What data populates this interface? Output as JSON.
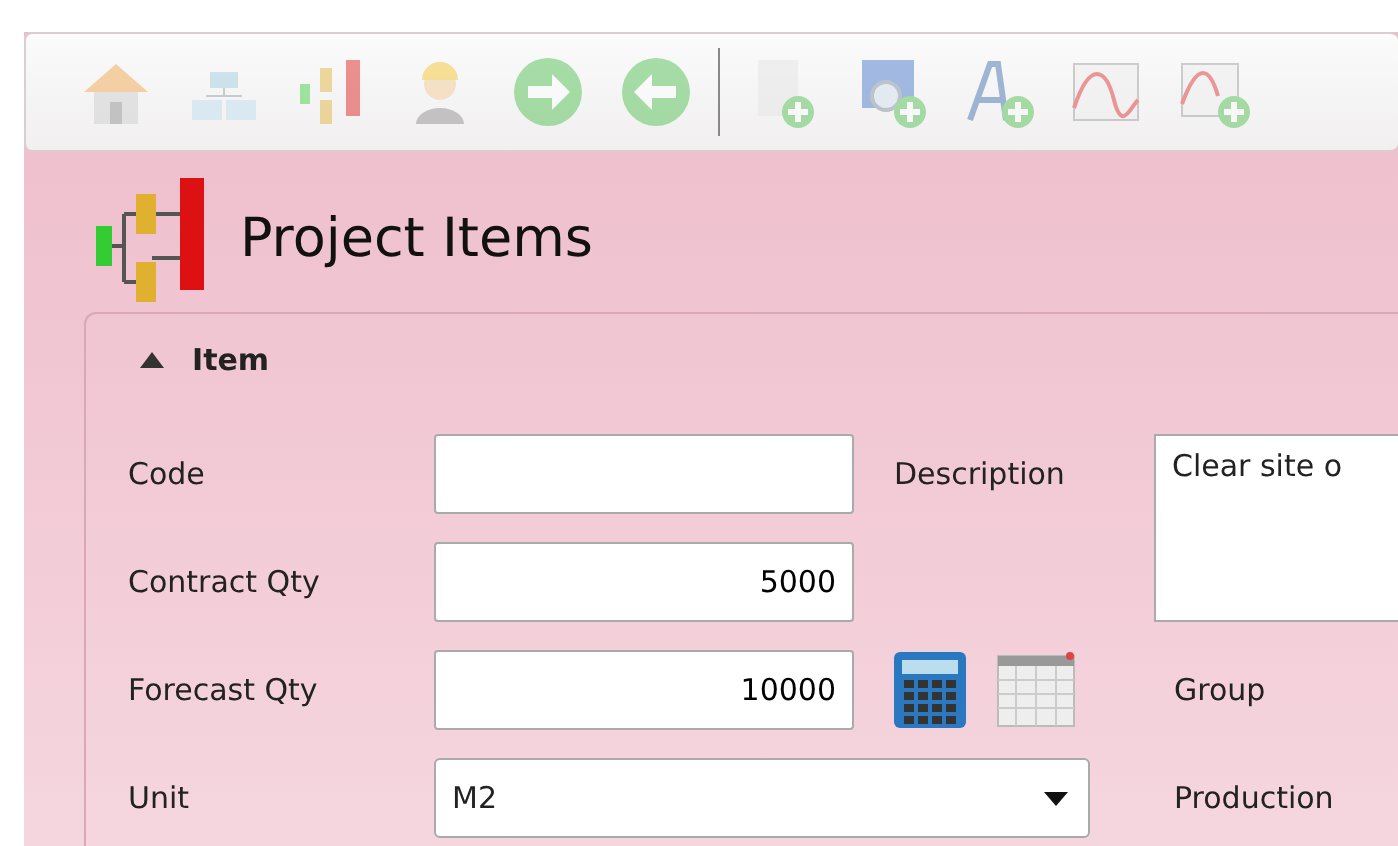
{
  "toolbar": [
    {
      "kind": "home",
      "disabled": true
    },
    {
      "kind": "tables",
      "disabled": true
    },
    {
      "kind": "hierarchy",
      "disabled": true
    },
    {
      "kind": "worker",
      "disabled": true
    },
    {
      "kind": "forward",
      "disabled": true
    },
    {
      "kind": "back",
      "disabled": true
    },
    {
      "kind": "separator"
    },
    {
      "kind": "page-add",
      "disabled": true
    },
    {
      "kind": "search-add",
      "disabled": true
    },
    {
      "kind": "font-add",
      "disabled": true
    },
    {
      "kind": "chart",
      "disabled": true
    },
    {
      "kind": "chart-add",
      "disabled": true
    }
  ],
  "page_title": "Project Items",
  "section": {
    "title": "Item",
    "expanded": true
  },
  "fields": [
    {
      "label": "Code"
    },
    {
      "label": "Contract Qty",
      "value": "5000"
    },
    {
      "label": "Forecast Qty",
      "value": "10000"
    },
    {
      "label": "Unit",
      "value": "M2"
    }
  ],
  "description": {
    "label": "Description",
    "value": "Clear site o"
  },
  "group_label": "Group",
  "production_label": "Production"
}
